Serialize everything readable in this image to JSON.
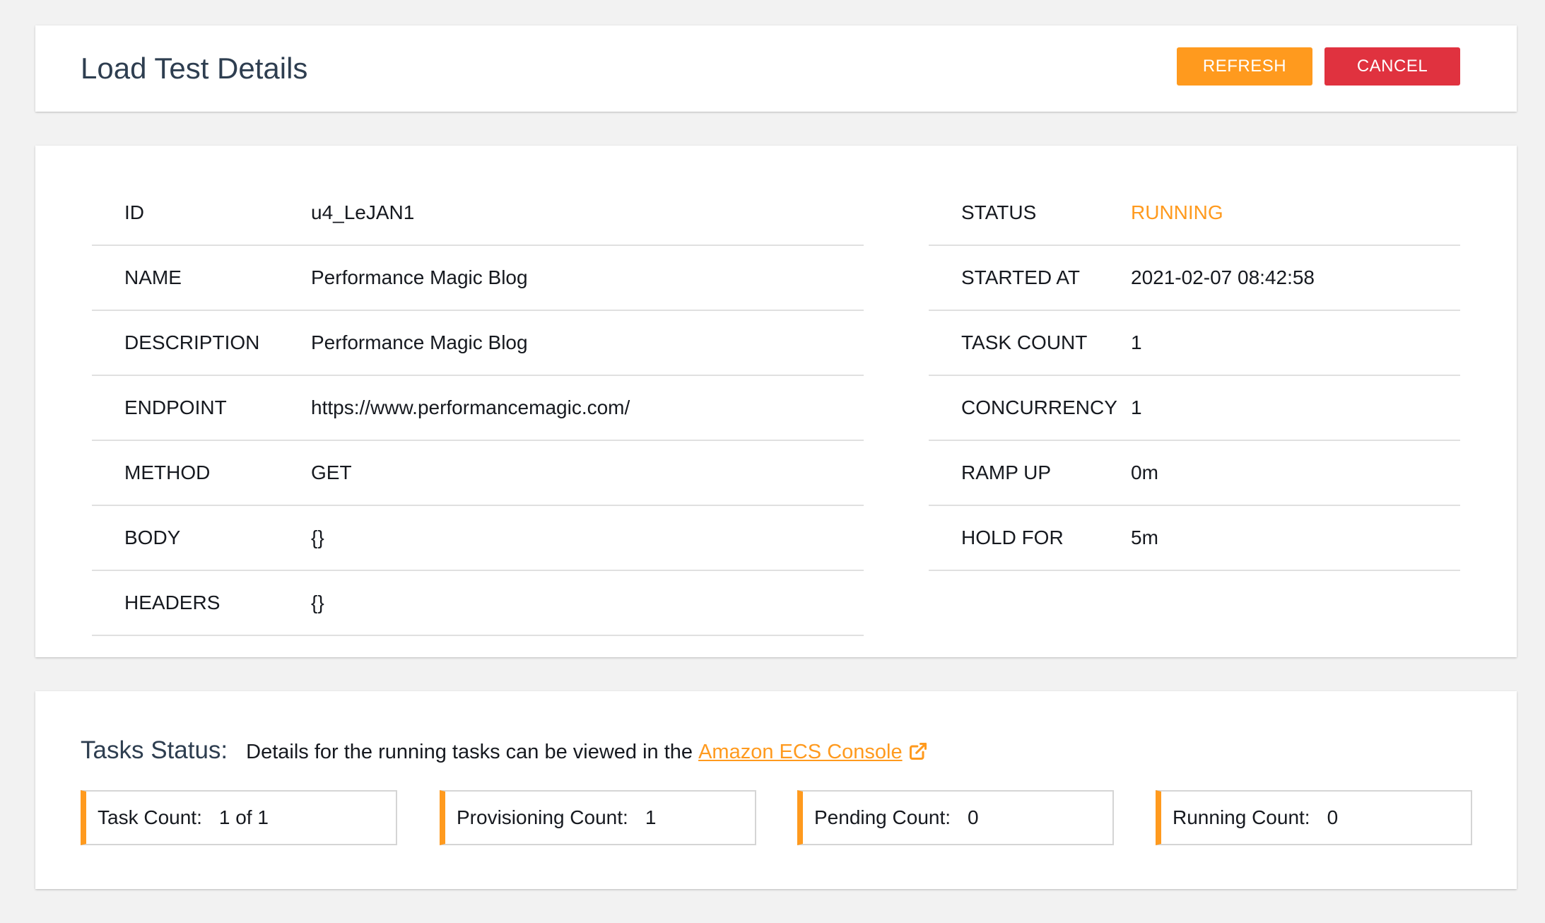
{
  "header": {
    "title": "Load Test Details",
    "refresh_label": "REFRESH",
    "cancel_label": "CANCEL"
  },
  "details": {
    "left": [
      {
        "label": "ID",
        "value": "u4_LeJAN1"
      },
      {
        "label": "NAME",
        "value": "Performance Magic Blog"
      },
      {
        "label": "DESCRIPTION",
        "value": "Performance Magic Blog"
      },
      {
        "label": "ENDPOINT",
        "value": "https://www.performancemagic.com/"
      },
      {
        "label": "METHOD",
        "value": "GET"
      },
      {
        "label": "BODY",
        "value": "{}"
      },
      {
        "label": "HEADERS",
        "value": "{}"
      }
    ],
    "right": [
      {
        "label": "STATUS",
        "value": "RUNNING"
      },
      {
        "label": "STARTED AT",
        "value": "2021-02-07 08:42:58"
      },
      {
        "label": "TASK COUNT",
        "value": "1"
      },
      {
        "label": "CONCURRENCY",
        "value": "1"
      },
      {
        "label": "RAMP UP",
        "value": "0m"
      },
      {
        "label": "HOLD FOR",
        "value": "5m"
      }
    ]
  },
  "tasks": {
    "title": "Tasks Status:",
    "description": "Details for the running tasks can be viewed in the",
    "link_label": "Amazon ECS Console",
    "link_icon": "external-link-icon",
    "counts": [
      {
        "label": "Task Count:",
        "value": "1 of 1"
      },
      {
        "label": "Provisioning Count:",
        "value": "1"
      },
      {
        "label": "Pending Count:",
        "value": "0"
      },
      {
        "label": "Running Count:",
        "value": "0"
      }
    ]
  },
  "colors": {
    "accent": "#ff9a1e",
    "danger": "#e0323f",
    "title": "#2e3e50",
    "background": "#f2f2f2"
  }
}
